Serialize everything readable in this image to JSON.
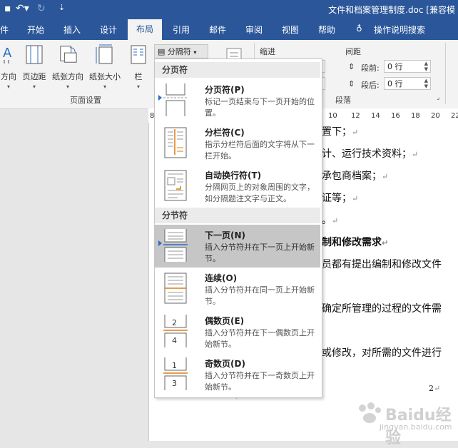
{
  "window": {
    "title": "文件和档案管理制度.doc [兼容模",
    "undo_icon": "undo-icon",
    "redo_icon": "redo-icon"
  },
  "tabs": [
    "件",
    "开始",
    "插入",
    "设计",
    "布局",
    "引用",
    "邮件",
    "审阅",
    "视图",
    "帮助",
    "操作说明搜索"
  ],
  "active_tab": "布局",
  "ribbon": {
    "page_setup": {
      "buttons": [
        "方向",
        "页边距",
        "纸张方向",
        "纸张大小",
        "栏"
      ],
      "group_label": "页面设置"
    },
    "breaks_button": "分隔符",
    "indent_label": "缩进",
    "spacing_label": "间距",
    "spacing_before_label": "段前:",
    "spacing_before_value": "0 行",
    "spacing_after_label": "段后:",
    "spacing_after_value": "0 行",
    "paragraph_group_label": "段落"
  },
  "ruler": [
    "8",
    "10",
    "12",
    "14",
    "16",
    "18",
    "20",
    "22"
  ],
  "document": {
    "lines": [
      "置下；",
      "计、运行技术资料；",
      "承包商档案；",
      "证等；",
      "。",
      "制和修改需求",
      "员都有提出编制和修改文件",
      "确定所管理的过程的文件需",
      "或修改，对所需的文件进行"
    ],
    "page_number": "2"
  },
  "menu": {
    "page_breaks_header": "分页符",
    "section_breaks_header": "分节符",
    "items": [
      {
        "title": "分页符(P)",
        "desc": "标记一页结束与下一页开始的位置。"
      },
      {
        "title": "分栏符(C)",
        "desc": "指示分栏符后面的文字将从下一栏开始。"
      },
      {
        "title": "自动换行符(T)",
        "desc": "分隔网页上的对象周围的文字，如分隔题注文字与正文。"
      },
      {
        "title": "下一页(N)",
        "desc": "插入分节符并在下一页上开始新节。"
      },
      {
        "title": "连续(O)",
        "desc": "插入分节符并在同一页上开始新节。"
      },
      {
        "title": "偶数页(E)",
        "desc": "插入分节符并在下一偶数页上开始新节。"
      },
      {
        "title": "奇数页(D)",
        "desc": "插入分节符并在下一奇数页上开始新节。"
      }
    ],
    "selected": "下一页(N)"
  },
  "watermark": {
    "text": "Baidu经验",
    "sub": "jingyan.baidu.com"
  },
  "colors": {
    "accent": "#2b579a",
    "selected": "#c6c6c6",
    "menu_header": "#ebebeb"
  }
}
